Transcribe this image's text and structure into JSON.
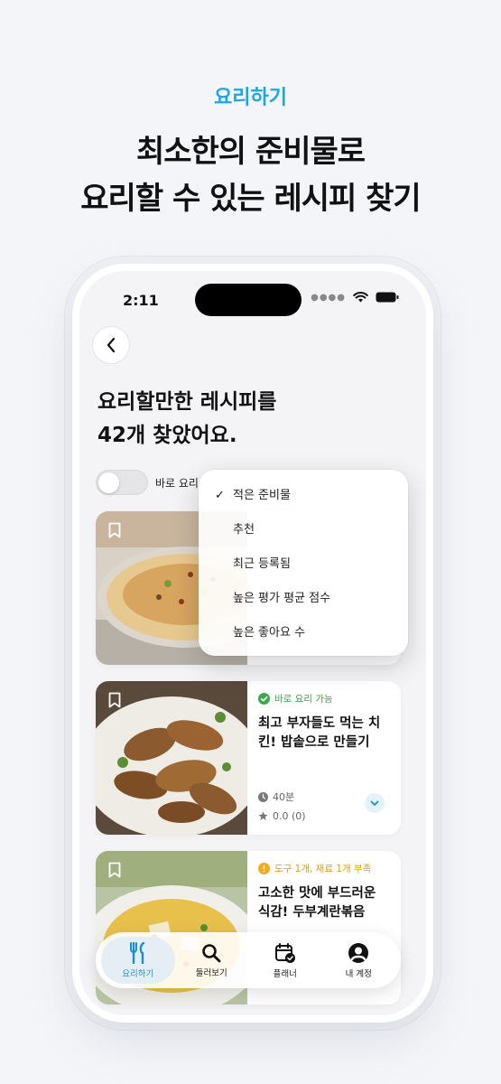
{
  "promo": {
    "eyebrow": "요리하기",
    "headline_line1": "최소한의 준비물로",
    "headline_line2": "요리할 수 있는 레시피 찾기"
  },
  "statusbar": {
    "time": "2:11"
  },
  "page": {
    "title_line1": "요리할만한 레시피를",
    "title_line2": "42개 찾았어요."
  },
  "filter": {
    "toggle_label": "바로 요리",
    "toggle_on": false
  },
  "sort_menu": {
    "selected": "적은 준비물",
    "options": [
      "적은 준비물",
      "추천",
      "최근 등록됨",
      "높은 평가 평균 점수",
      "높은 좋아요 수"
    ]
  },
  "recipes": [
    {
      "status": "바로 요리 가능",
      "status_type": "ok",
      "title": "최고 부자들도 먹는 치킨! 밥솥으로 만들기",
      "time": "40분",
      "rating": "0.0 (0)"
    },
    {
      "status": "도구 1개, 재료 1개 부족",
      "status_type": "warn",
      "title": "고소한 맛에 부드러운 식감! 두부계란볶음"
    }
  ],
  "tabbar": {
    "items": [
      {
        "label": "요리하기",
        "icon": "utensils-icon",
        "active": true
      },
      {
        "label": "둘러보기",
        "icon": "search-icon",
        "active": false
      },
      {
        "label": "플래너",
        "icon": "calendar-check-icon",
        "active": false
      },
      {
        "label": "내 계정",
        "icon": "account-icon",
        "active": false
      }
    ]
  },
  "colors": {
    "accent": "#1aa7e6",
    "ok": "#3ea74c",
    "warn": "#e59b17"
  }
}
